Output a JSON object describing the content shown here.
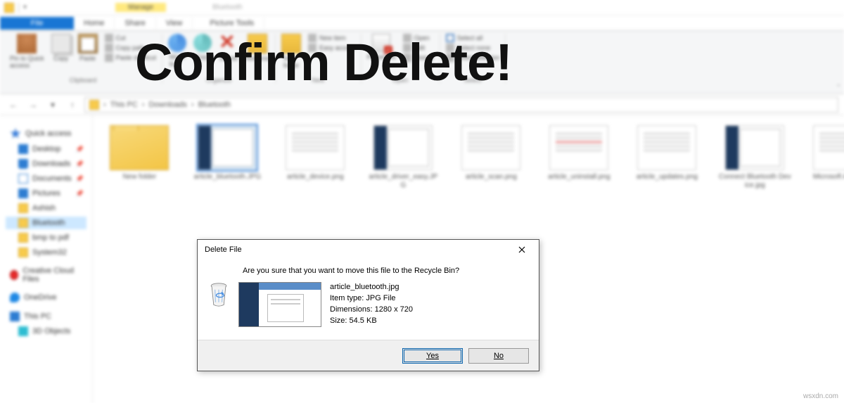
{
  "titlebar": {
    "context_tab": "Manage",
    "context_label": "Bluetooth",
    "picture_tools": "Picture Tools"
  },
  "ribbon_tabs": {
    "file": "File",
    "home": "Home",
    "share": "Share",
    "view": "View"
  },
  "ribbon": {
    "clipboard": {
      "pin": "Pin to Quick\naccess",
      "copy": "Copy",
      "paste": "Paste",
      "cut": "Cut",
      "copy_path": "Copy path",
      "paste_shortcut": "Paste shortcut",
      "label": "Clipboard"
    },
    "organize": {
      "move": "Move\nto",
      "copy": "Copy\nto",
      "del": "Delete",
      "rename": "Rename",
      "label": "Organize"
    },
    "new": {
      "folder": "New\nfolder",
      "item": "New item",
      "easy": "Easy access",
      "label": "New"
    },
    "open": {
      "props": "Properties",
      "open": "Open",
      "edit": "Edit",
      "history": "History",
      "label": "Open"
    },
    "select": {
      "all": "Select all",
      "none": "Select none",
      "invert": "Invert selection",
      "label": "Select"
    }
  },
  "breadcrumb": {
    "pc": "This PC",
    "downloads": "Downloads",
    "bluetooth": "Bluetooth"
  },
  "sidebar": {
    "quick": "Quick access",
    "desktop": "Desktop",
    "downloads": "Downloads",
    "documents": "Documents",
    "pictures": "Pictures",
    "ashish": "Ashish",
    "bluetooth": "Bluetooth",
    "bmp": "bmp to pdf",
    "sys32": "System32",
    "cc": "Creative Cloud Files",
    "onedrive": "OneDrive",
    "thispc": "This PC",
    "objects": "3D Objects"
  },
  "files": [
    {
      "name": "New folder",
      "type": "folder"
    },
    {
      "name": "article_bluetooth.JPG",
      "type": "shot",
      "selected": true
    },
    {
      "name": "article_device.png",
      "type": "doc"
    },
    {
      "name": "article_driver_easy.JPG",
      "type": "shot2"
    },
    {
      "name": "article_scan.png",
      "type": "doc"
    },
    {
      "name": "article_uninstall.png",
      "type": "doc"
    },
    {
      "name": "article_updates.png",
      "type": "doc"
    },
    {
      "name": "Connect Bluetooth Device.jpg",
      "type": "shot"
    },
    {
      "name": "Microsoft Apps.png",
      "type": "doc"
    }
  ],
  "headline": "Confirm Delete!",
  "dialog": {
    "title": "Delete File",
    "question": "Are you sure that you want to move this file to the Recycle Bin?",
    "filename": "article_bluetooth.jpg",
    "itemtype": "Item type: JPG File",
    "dimensions": "Dimensions: 1280 x 720",
    "size": "Size: 54.5 KB",
    "yes": "Yes",
    "no": "No"
  },
  "watermark": "wsxdn.com"
}
